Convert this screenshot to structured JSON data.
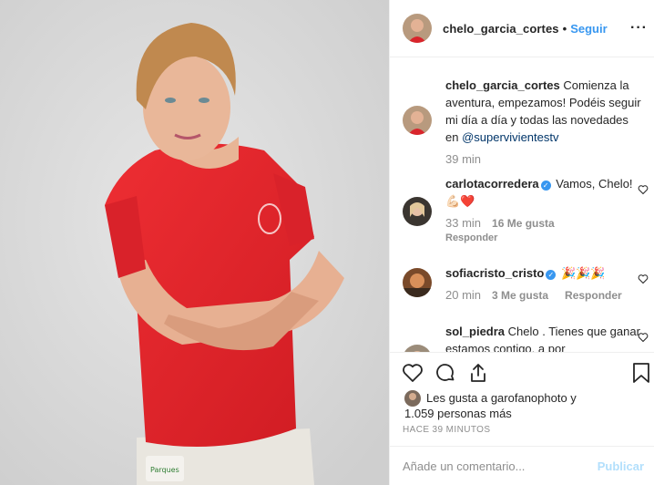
{
  "header": {
    "username": "chelo_garcia_cortes",
    "separator": "•",
    "follow_label": "Seguir",
    "more_label": "···"
  },
  "caption": {
    "username": "chelo_garcia_cortes",
    "text": " Comienza la aventura, empezamos! Podéis seguir mi día a día y todas las novedades en ",
    "mention": "@supervivientestv",
    "time": "39 min"
  },
  "comments": [
    {
      "username": "carlotacorredera",
      "verified": true,
      "text": " Vamos, Chelo! 💪🏻❤️",
      "time": "33 min",
      "likes": "16 Me gusta",
      "reply": "Responder"
    },
    {
      "username": "sofiacristo_cristo",
      "verified": true,
      "text": " 🎉🎉🎉",
      "time": "20 min",
      "likes": "3 Me gusta",
      "reply": "Responder"
    },
    {
      "username": "sol_piedra",
      "verified": false,
      "text": " Chelo . Tienes que ganar estamos contigo, a por"
    }
  ],
  "likes": {
    "line1": "Les gusta a garofanophoto y",
    "line2": "1.059 personas más"
  },
  "time_ago": "Hace 39 minutos",
  "add_comment": {
    "placeholder": "Añade un comentario...",
    "publish_label": "Publicar"
  },
  "colors": {
    "link": "#3897f0",
    "mention": "#003569",
    "muted": "#8e8e8e",
    "publish_disabled": "#b2dffc",
    "shirt": "#e3252b"
  },
  "icons": [
    "heart-icon",
    "comment-icon",
    "share-icon",
    "bookmark-icon",
    "verified-icon",
    "more-options-icon"
  ]
}
